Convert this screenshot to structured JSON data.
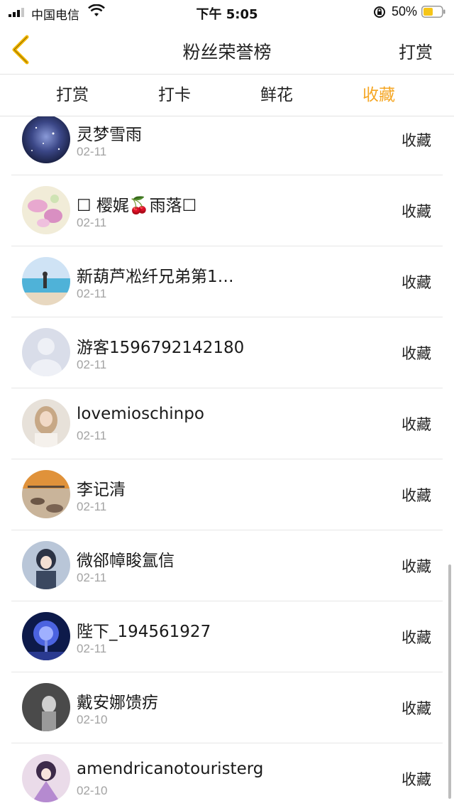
{
  "status_bar": {
    "carrier": "中国电信",
    "time": "下午 5:05",
    "battery_text": "50%"
  },
  "header": {
    "title": "粉丝荣誉榜",
    "action_label": "打赏"
  },
  "tabs": [
    {
      "label": "打赏",
      "active": false
    },
    {
      "label": "打卡",
      "active": false
    },
    {
      "label": "鲜花",
      "active": false
    },
    {
      "label": "收藏",
      "active": true
    }
  ],
  "list": {
    "items": [
      {
        "name": "灵梦雪雨",
        "date": "02-11",
        "action": "收藏",
        "avatar": "starry-sky"
      },
      {
        "name": "☐ 樱娓🍒雨落☐",
        "date": "02-11",
        "action": "收藏",
        "avatar": "pink-flowers"
      },
      {
        "name": "新葫芦凇纤兄弟第1…",
        "date": "02-11",
        "action": "收藏",
        "avatar": "beach-girl"
      },
      {
        "name": "游客1596792142180",
        "date": "02-11",
        "action": "收藏",
        "avatar": "default-user"
      },
      {
        "name": "lovemioschinpo",
        "date": "02-11",
        "action": "收藏",
        "avatar": "girl-portrait"
      },
      {
        "name": "李记清",
        "date": "02-11",
        "action": "收藏",
        "avatar": "sunset-rocks"
      },
      {
        "name": "微郤幛睃氲信",
        "date": "02-11",
        "action": "收藏",
        "avatar": "anime-girl"
      },
      {
        "name": "陛下_194561927",
        "date": "02-11",
        "action": "收藏",
        "avatar": "blue-tree"
      },
      {
        "name": "戴安娜馈疠",
        "date": "02-10",
        "action": "收藏",
        "avatar": "dark-figure"
      },
      {
        "name": "amendricanotouristerg",
        "date": "02-10",
        "action": "收藏",
        "avatar": "anime-doll"
      }
    ]
  },
  "colors": {
    "accent": "#f5a623",
    "divider": "#e6e6e6",
    "secondary_text": "#a3a3a3"
  }
}
